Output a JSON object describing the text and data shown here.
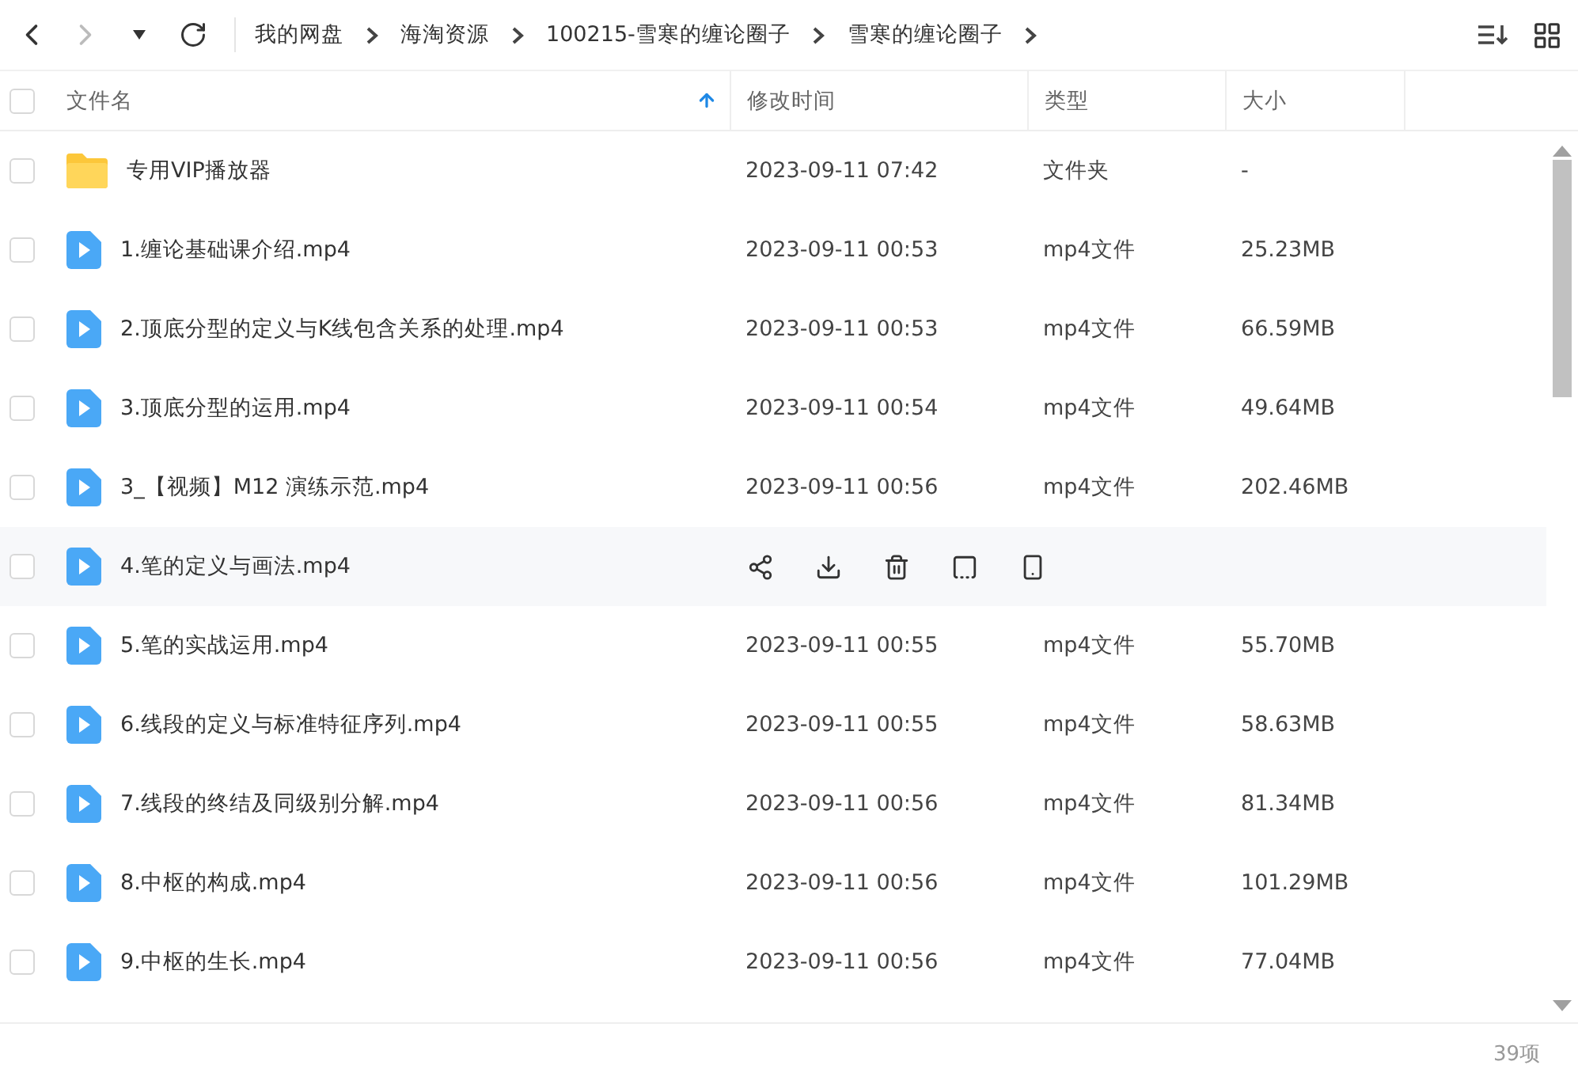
{
  "breadcrumb": [
    "我的网盘",
    "海淘资源",
    "100215-雪寒的缠论圈子",
    "雪寒的缠论圈子"
  ],
  "select_all": {
    "checked": false
  },
  "columns": [
    {
      "label": "文件名",
      "sorted": true
    },
    {
      "label": "修改时间",
      "sorted": false
    },
    {
      "label": "类型",
      "sorted": false
    },
    {
      "label": "大小",
      "sorted": false
    }
  ],
  "rows": [
    {
      "kind": "folder",
      "name": "专用VIP播放器",
      "time": "2023-09-11 07:42",
      "type": "文件夹",
      "size": "-",
      "hovered": false,
      "checked": false
    },
    {
      "kind": "video",
      "name": "1.缠论基础课介绍.mp4",
      "time": "2023-09-11 00:53",
      "type": "mp4文件",
      "size": "25.23MB",
      "hovered": false,
      "checked": false
    },
    {
      "kind": "video",
      "name": "2.顶底分型的定义与K线包含关系的处理.mp4",
      "time": "2023-09-11 00:53",
      "type": "mp4文件",
      "size": "66.59MB",
      "hovered": false,
      "checked": false
    },
    {
      "kind": "video",
      "name": "3.顶底分型的运用.mp4",
      "time": "2023-09-11 00:54",
      "type": "mp4文件",
      "size": "49.64MB",
      "hovered": false,
      "checked": false
    },
    {
      "kind": "video",
      "name": "3_【视频】M12 演练示范.mp4",
      "time": "2023-09-11 00:56",
      "type": "mp4文件",
      "size": "202.46MB",
      "hovered": false,
      "checked": false
    },
    {
      "kind": "video",
      "name": "4.笔的定义与画法.mp4",
      "hovered": true,
      "checked": false
    },
    {
      "kind": "video",
      "name": "5.笔的实战运用.mp4",
      "time": "2023-09-11 00:55",
      "type": "mp4文件",
      "size": "55.70MB",
      "hovered": false,
      "checked": false
    },
    {
      "kind": "video",
      "name": "6.线段的定义与标准特征序列.mp4",
      "time": "2023-09-11 00:55",
      "type": "mp4文件",
      "size": "58.63MB",
      "hovered": false,
      "checked": false
    },
    {
      "kind": "video",
      "name": "7.线段的终结及同级别分解.mp4",
      "time": "2023-09-11 00:56",
      "type": "mp4文件",
      "size": "81.34MB",
      "hovered": false,
      "checked": false
    },
    {
      "kind": "video",
      "name": "8.中枢的构成.mp4",
      "time": "2023-09-11 00:56",
      "type": "mp4文件",
      "size": "101.29MB",
      "hovered": false,
      "checked": false
    },
    {
      "kind": "video",
      "name": "9.中枢的生长.mp4",
      "time": "2023-09-11 00:56",
      "type": "mp4文件",
      "size": "77.04MB",
      "hovered": false,
      "checked": false
    }
  ],
  "status_bar": {
    "count": "39项"
  }
}
